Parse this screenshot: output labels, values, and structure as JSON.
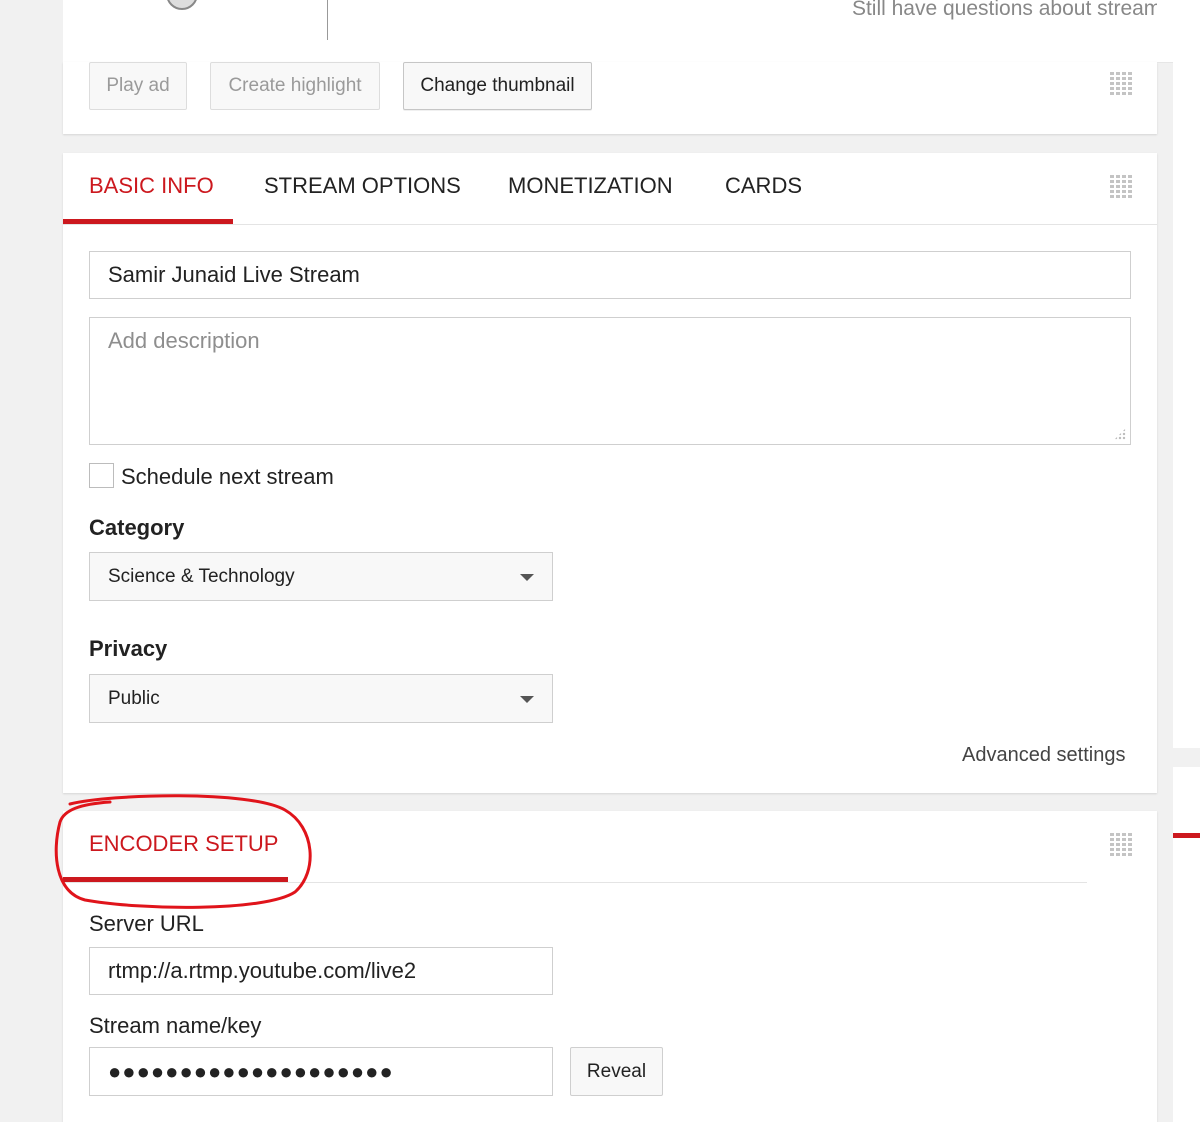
{
  "header": {
    "help_text": "Still have questions about streaming?"
  },
  "actions": {
    "play_ad": "Play ad",
    "create_highlight": "Create highlight",
    "change_thumbnail": "Change thumbnail"
  },
  "tabs": [
    {
      "label": "BASIC INFO",
      "active": true
    },
    {
      "label": "STREAM OPTIONS",
      "active": false
    },
    {
      "label": "MONETIZATION",
      "active": false
    },
    {
      "label": "CARDS",
      "active": false
    }
  ],
  "basic_info": {
    "title_value": "Samir Junaid Live Stream",
    "description_placeholder": "Add description",
    "schedule_label": "Schedule next stream",
    "schedule_checked": false,
    "category_label": "Category",
    "category_value": "Science & Technology",
    "privacy_label": "Privacy",
    "privacy_value": "Public",
    "advanced_link": "Advanced settings"
  },
  "encoder": {
    "title": "ENCODER SETUP",
    "server_url_label": "Server URL",
    "server_url_value": "rtmp://a.rtmp.youtube.com/live2",
    "stream_key_label": "Stream name/key",
    "stream_key_masked": "●●●●●●●●●●●●●●●●●●●●",
    "reveal_button": "Reveal"
  },
  "colors": {
    "accent": "#cc181e",
    "annotation": "#e0141b",
    "background": "#f1f1f1"
  },
  "icons": [
    "drag-handle-icon",
    "dropdown-caret-icon",
    "resize-grip-icon",
    "avatar"
  ]
}
